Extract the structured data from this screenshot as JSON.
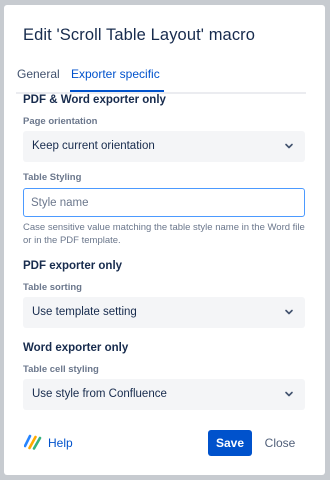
{
  "dialog": {
    "title": "Edit 'Scroll Table Layout' macro"
  },
  "tabs": [
    {
      "label": "General",
      "active": false
    },
    {
      "label": "Exporter specific",
      "active": true
    }
  ],
  "pdf_word_section": {
    "heading": "PDF & Word exporter only",
    "page_orientation": {
      "label": "Page orientation",
      "value": "Keep current orientation"
    },
    "table_styling": {
      "label": "Table Styling",
      "placeholder": "Style name",
      "value": "",
      "help": "Case sensitive value matching the table style name in the Word file or in the PDF template."
    }
  },
  "pdf_section": {
    "heading": "PDF exporter only",
    "table_sorting": {
      "label": "Table sorting",
      "value": "Use template setting"
    }
  },
  "word_section": {
    "heading": "Word exporter only",
    "cell_styling": {
      "label": "Table cell styling",
      "value": "Use style from Confluence"
    }
  },
  "footer": {
    "help_label": "Help",
    "save_label": "Save",
    "close_label": "Close"
  },
  "colors": {
    "primary": "#0052cc",
    "focus_border": "#4c9aff",
    "text": "#172b4d",
    "subtle_text": "#6b778c",
    "field_bg": "#f4f5f7"
  },
  "icons": {
    "help_logo": "scroll-logo-icon",
    "chevron": "chevron-down-icon"
  }
}
